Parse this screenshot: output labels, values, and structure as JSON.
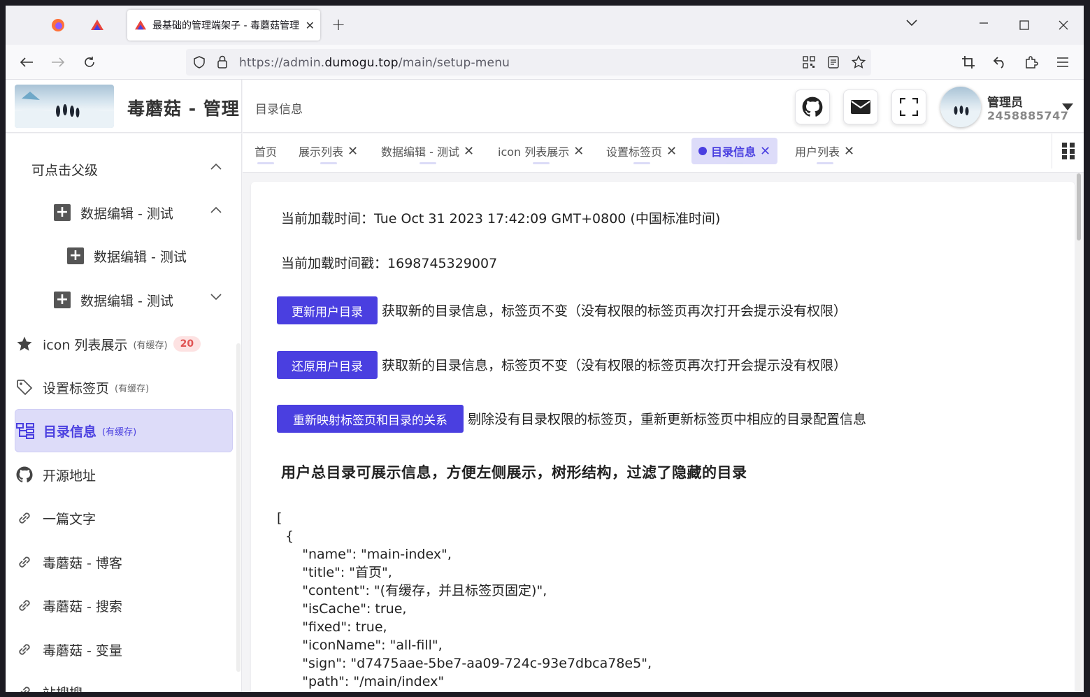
{
  "browser": {
    "active_tab_title": "最基础的管理端架子 - 毒蘑菇管理",
    "url_prefix": "https://admin.",
    "url_domain": "dumogu.top",
    "url_path": "/main/setup-menu"
  },
  "app": {
    "title": "毒蘑菇 - 管理",
    "breadcrumb": "目录信息",
    "user_name": "管理员",
    "user_id": "2458885747",
    "accent_color": "#4a3fe0"
  },
  "sidebar": {
    "items": [
      {
        "label": "可点击父级"
      },
      {
        "label": "数据编辑 - 测试"
      },
      {
        "label": "数据编辑 - 测试"
      },
      {
        "label": "数据编辑 - 测试"
      },
      {
        "label": "icon 列表展示",
        "cache": "(有缓存)",
        "badge": "20"
      },
      {
        "label": "设置标签页",
        "cache": "(有缓存)"
      },
      {
        "label": "目录信息",
        "cache": "(有缓存)"
      },
      {
        "label": "开源地址"
      },
      {
        "label": "一篇文字"
      },
      {
        "label": "毒蘑菇 - 博客"
      },
      {
        "label": "毒蘑菇 - 搜索"
      },
      {
        "label": "毒蘑菇 - 变量"
      },
      {
        "label": "站搜搜"
      }
    ]
  },
  "tabs": [
    {
      "label": "首页"
    },
    {
      "label": "展示列表"
    },
    {
      "label": "数据编辑 - 测试"
    },
    {
      "label": "icon 列表展示"
    },
    {
      "label": "设置标签页"
    },
    {
      "label": "目录信息"
    },
    {
      "label": "用户列表"
    }
  ],
  "main": {
    "load_time_label": "当前加载时间：",
    "load_time_value": "Tue Oct 31 2023 17:42:09 GMT+0800 (中国标准时间)",
    "timestamp_label": "当前加载时间戳：",
    "timestamp_value": "1698745329007",
    "actions": [
      {
        "button": "更新用户目录",
        "desc": "获取新的目录信息，标签页不变（没有权限的标签页再次打开会提示没有权限）"
      },
      {
        "button": "还原用户目录",
        "desc": "获取新的目录信息，标签页不变（没有权限的标签页再次打开会提示没有权限）"
      },
      {
        "button": "重新映射标签页和目录的关系",
        "desc": "剔除没有目录权限的标签页，重新更新标签页中相应的目录配置信息"
      }
    ],
    "section_title": "用户总目录可展示信息，方便左侧展示，树形结构，过滤了隐藏的目录",
    "json_text": "[\n  {\n      \"name\": \"main-index\",\n      \"title\": \"首页\",\n      \"content\": \"(有缓存，并且标签页固定)\",\n      \"isCache\": true,\n      \"fixed\": true,\n      \"iconName\": \"all-fill\",\n      \"sign\": \"d7475aae-5be7-aa09-724c-93e7dbca78e5\",\n      \"path\": \"/main/index\"\n  },"
  }
}
